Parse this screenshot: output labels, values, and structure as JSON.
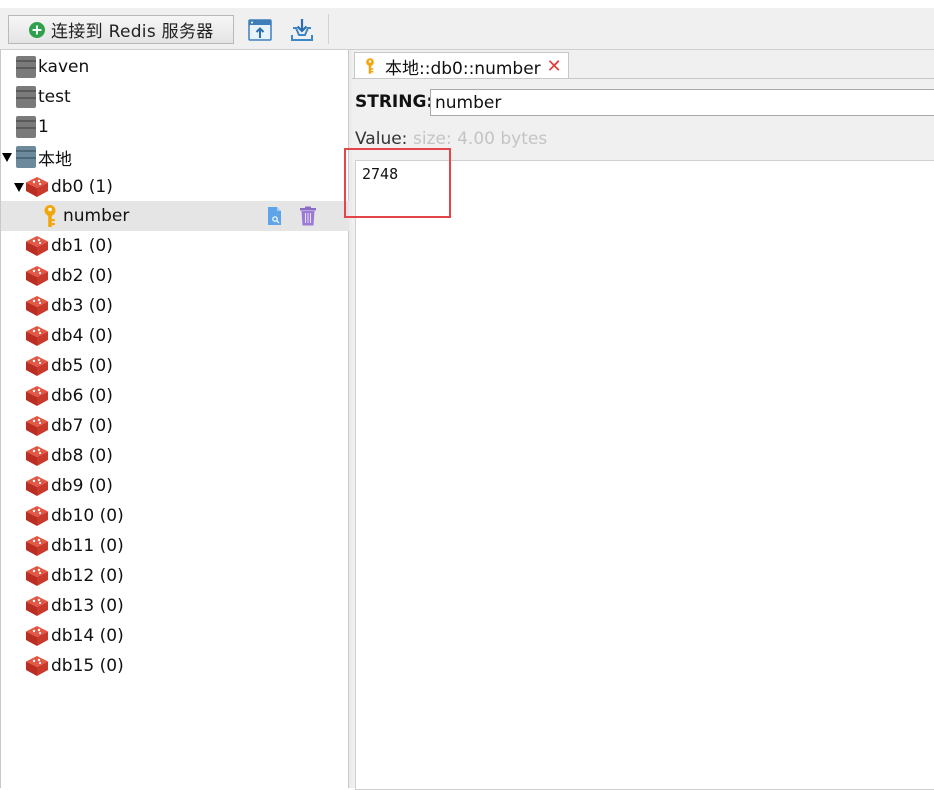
{
  "toolbar": {
    "connect_label": "连接到 Redis 服务器",
    "import_icon": "import-window-icon",
    "export_icon": "download-tray-icon"
  },
  "tree": {
    "servers": [
      {
        "label": "kaven"
      },
      {
        "label": "test"
      },
      {
        "label": "1"
      },
      {
        "label": "本地",
        "expanded": true
      }
    ],
    "databases": [
      {
        "label": "db0  (1)",
        "expanded": true
      },
      {
        "label": "db1  (0)"
      },
      {
        "label": "db2  (0)"
      },
      {
        "label": "db3  (0)"
      },
      {
        "label": "db4  (0)"
      },
      {
        "label": "db5  (0)"
      },
      {
        "label": "db6  (0)"
      },
      {
        "label": "db7  (0)"
      },
      {
        "label": "db8  (0)"
      },
      {
        "label": "db9  (0)"
      },
      {
        "label": "db10  (0)"
      },
      {
        "label": "db11  (0)"
      },
      {
        "label": "db12  (0)"
      },
      {
        "label": "db13  (0)"
      },
      {
        "label": "db14  (0)"
      },
      {
        "label": "db15  (0)"
      }
    ],
    "selected_key": {
      "label": "number"
    }
  },
  "editor": {
    "tab_title": "本地::db0::number",
    "type_label": "STRING:",
    "key_name": "number",
    "value_label": "Value:",
    "size_label": "size: 4.00 bytes",
    "value_text": "2748"
  },
  "colors": {
    "accent_red": "#e2464a",
    "redis_red": "#d33a2c",
    "key_gold": "#f2a60c",
    "connect_green": "#2fa14c"
  }
}
